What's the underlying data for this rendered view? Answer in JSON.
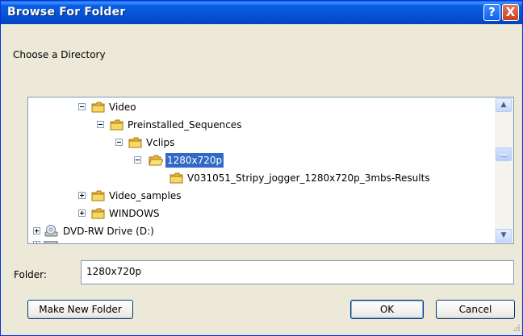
{
  "window": {
    "title": "Browse For Folder",
    "help_label": "?",
    "close_label": "X"
  },
  "prompt": "Choose a Directory",
  "tree": {
    "items": [
      {
        "label": "Video",
        "expander": "minus"
      },
      {
        "label": "Preinstalled_Sequences",
        "expander": "minus"
      },
      {
        "label": "Vclips",
        "expander": "minus"
      },
      {
        "label": "1280x720p",
        "expander": "minus",
        "selected": true
      },
      {
        "label": "V031051_Stripy_jogger_1280x720p_3mbs-Results",
        "expander": "none"
      },
      {
        "label": "Video_samples",
        "expander": "plus"
      },
      {
        "label": "WINDOWS",
        "expander": "plus"
      },
      {
        "label": "DVD-RW Drive (D:)",
        "expander": "plus",
        "icon": "dvd-drive-icon"
      }
    ],
    "scroll_up_glyph": "▲",
    "scroll_down_glyph": "▼"
  },
  "folder_field": {
    "label": "Folder:",
    "value": "1280x720p"
  },
  "buttons": {
    "make_new_folder": "Make New Folder",
    "ok": "OK",
    "cancel": "Cancel"
  },
  "colors": {
    "title_bar": "#0a5ee6",
    "selection": "#316ac5",
    "dialog_bg": "#ece9d8",
    "folder": "#f2c94c"
  }
}
